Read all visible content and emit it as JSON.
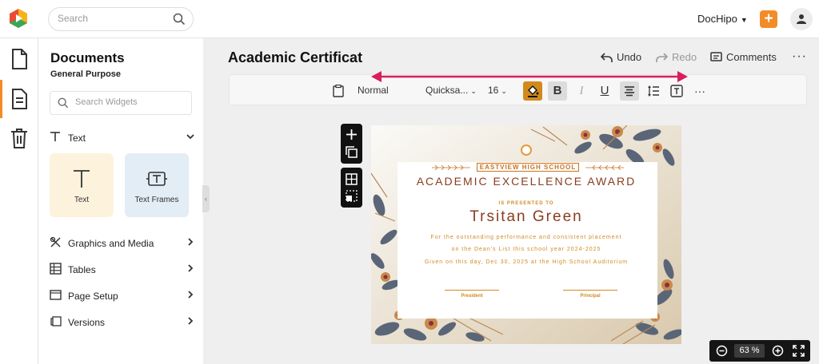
{
  "colors": {
    "brand": "#f28c28",
    "accent_arrow": "#d81e5b",
    "cert_dark": "#8a3c1f",
    "cert_gold": "#d18a24"
  },
  "header": {
    "search_placeholder": "Search",
    "account_label": "DocHipo",
    "plus_label": "+"
  },
  "rail": {
    "items": [
      "document-icon",
      "page-icon",
      "trash-icon"
    ],
    "active": 1
  },
  "panel": {
    "title": "Documents",
    "subtitle": "General Purpose",
    "widget_search_placeholder": "Search Widgets",
    "text_section": "Text",
    "cards": [
      {
        "label": "Text"
      },
      {
        "label": "Text Frames"
      }
    ],
    "sections": [
      {
        "label": "Graphics and Media",
        "icon": "shapes-icon"
      },
      {
        "label": "Tables",
        "icon": "table-icon"
      },
      {
        "label": "Page Setup",
        "icon": "page-setup-icon"
      },
      {
        "label": "Versions",
        "icon": "versions-icon"
      }
    ]
  },
  "editor": {
    "doc_title": "Academic Certificat",
    "undo_label": "Undo",
    "redo_label": "Redo",
    "comments_label": "Comments",
    "more_label": "···"
  },
  "toolbar": {
    "style_value": "Normal",
    "font_value": "Quicksa...",
    "size_value": "16",
    "bold_label": "B",
    "italic_label": "I",
    "underline_label": "U",
    "more_label": "···"
  },
  "certificate": {
    "school": "EASTVIEW HIGH SCHOOL",
    "award": "ACADEMIC EXCELLENCE AWARD",
    "presented": "IS PRESENTED TO",
    "recipient": "Trsitan Green",
    "line1": "For the outstanding performance and consistent placement",
    "line2": "on the Dean's List this school year 2024-2025",
    "line3": "Given on this day, Dec 30, 2025 at the High School Auditorium",
    "sig_left": "President",
    "sig_right": "Principal"
  },
  "zoom": {
    "value": "63",
    "unit": "%"
  }
}
